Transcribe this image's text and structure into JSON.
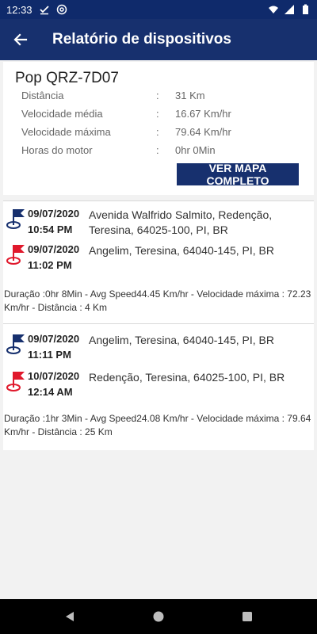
{
  "status_bar": {
    "time": "12:33",
    "icons": [
      "download-done-icon",
      "at-sign-icon",
      "wifi-icon",
      "signal-icon",
      "battery-icon"
    ]
  },
  "app_bar": {
    "title": "Relatório de dispositivos",
    "back_icon": "arrow-back-icon"
  },
  "summary": {
    "vehicle_name": "Pop QRZ-7D07",
    "stats": [
      {
        "label": "Distância",
        "value": "31 Km"
      },
      {
        "label": "Velocidade média",
        "value": "16.67 Km/hr"
      },
      {
        "label": "Velocidade máxima",
        "value": "79.64 Km/hr"
      },
      {
        "label": "Horas do motor",
        "value": "0hr 0Min"
      }
    ],
    "separator": ":",
    "map_button_label": "VER MAPA COMPLETO"
  },
  "trips": [
    {
      "start": {
        "date": "09/07/2020",
        "time": "10:54 PM",
        "address": "Avenida Walfrido Salmito, Redenção, Teresina, 64025-100, PI, BR"
      },
      "end": {
        "date": "09/07/2020",
        "time": "11:02 PM",
        "address": "Angelim, Teresina, 64040-145, PI, BR"
      },
      "summary": "Duração :0hr 8Min - Avg Speed44.45 Km/hr - Velocidade máxima : 72.23 Km/hr - Distância : 4 Km"
    },
    {
      "start": {
        "date": "09/07/2020",
        "time": "11:11 PM",
        "address": "Angelim, Teresina, 64040-145, PI, BR"
      },
      "end": {
        "date": "10/07/2020",
        "time": "12:14 AM",
        "address": "Redenção, Teresina, 64025-100, PI, BR"
      },
      "summary": "Duração :1hr 3Min - Avg Speed24.08 Km/hr - Velocidade máxima : 79.64 Km/hr - Distância : 25 Km"
    }
  ],
  "colors": {
    "primary": "#17306e",
    "status_bar": "#0f2a6b",
    "start_flag": "#17306e",
    "end_flag": "#e0192c"
  }
}
